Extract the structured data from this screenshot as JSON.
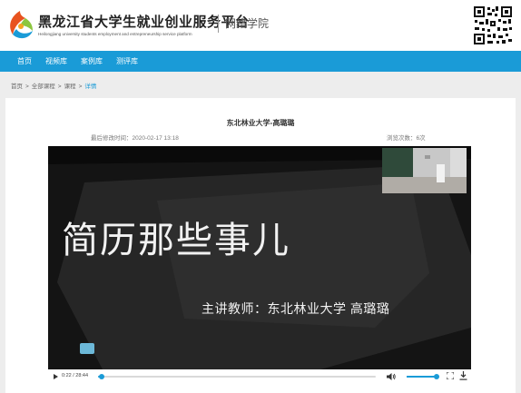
{
  "header": {
    "title": "黑龙江省大学生就业创业服务平台",
    "subtitle": "Heilongjiang university students employment and entrepreneurship service platform",
    "tag": "网络学院",
    "logo_icon": "swirl-logo-icon",
    "qr_icon": "qr-code-icon"
  },
  "nav": {
    "items": [
      {
        "label": "首页"
      },
      {
        "label": "视频库"
      },
      {
        "label": "案例库"
      },
      {
        "label": "测评库"
      }
    ]
  },
  "breadcrumb": {
    "items": [
      "首页",
      "全部课程",
      "课程"
    ],
    "current": "详情",
    "separator": ">"
  },
  "course": {
    "title": "东北林业大学-高璐璐",
    "modified_label": "最后修改时间：",
    "modified_value": "2020-02-17 13:18",
    "views_label": "浏览次数：",
    "views_value": "6次"
  },
  "video": {
    "slide_title": "简历那些事儿",
    "slide_subtitle": "主讲教师：东北林业大学 高璐璐",
    "time_display": "0:22 / 28:44",
    "progress": 0.013,
    "volume": 0.92
  },
  "colors": {
    "accent": "#1a9bd7",
    "nav_bg": "#1a9bd7",
    "page_bg": "#ededed"
  }
}
